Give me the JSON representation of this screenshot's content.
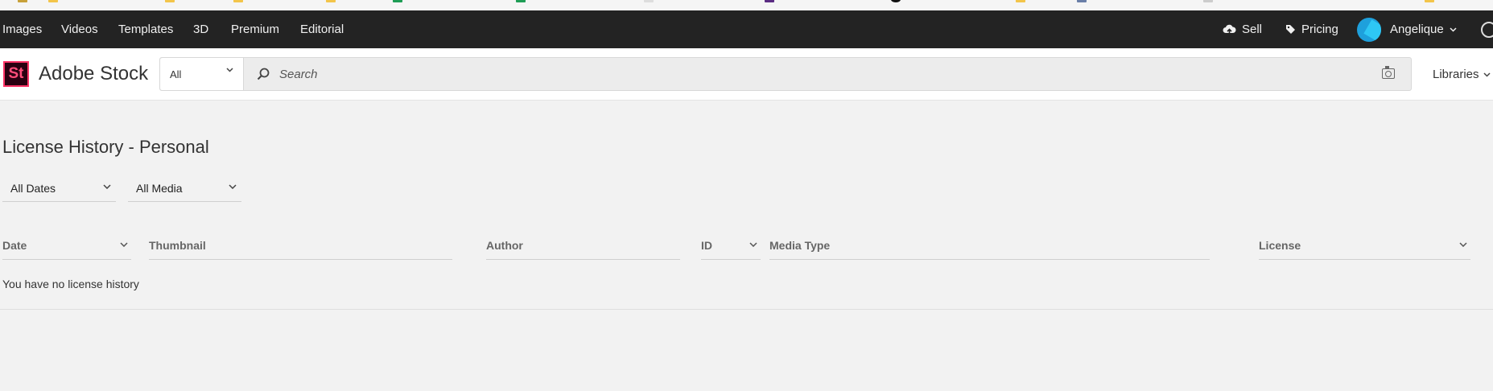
{
  "topnav": {
    "links": [
      "Images",
      "Videos",
      "Templates",
      "3D",
      "Premium",
      "Editorial"
    ],
    "sell_label": "Sell",
    "pricing_label": "Pricing",
    "user_name": "Angelique"
  },
  "header": {
    "logo_text": "St",
    "brand": "Adobe Stock",
    "filter_value": "All",
    "search_placeholder": "Search",
    "libraries_label": "Libraries"
  },
  "page": {
    "title": "License History - Personal",
    "filters": {
      "dates": "All Dates",
      "media": "All Media"
    },
    "columns": {
      "date": "Date",
      "thumbnail": "Thumbnail",
      "author": "Author",
      "id": "ID",
      "media_type": "Media Type",
      "license": "License"
    },
    "empty_message": "You have no license history"
  },
  "colors": {
    "nav_bg": "#232323",
    "page_bg": "#f2f2f2",
    "logo_accent": "#ff3366",
    "avatar": "#1ea0dc"
  }
}
